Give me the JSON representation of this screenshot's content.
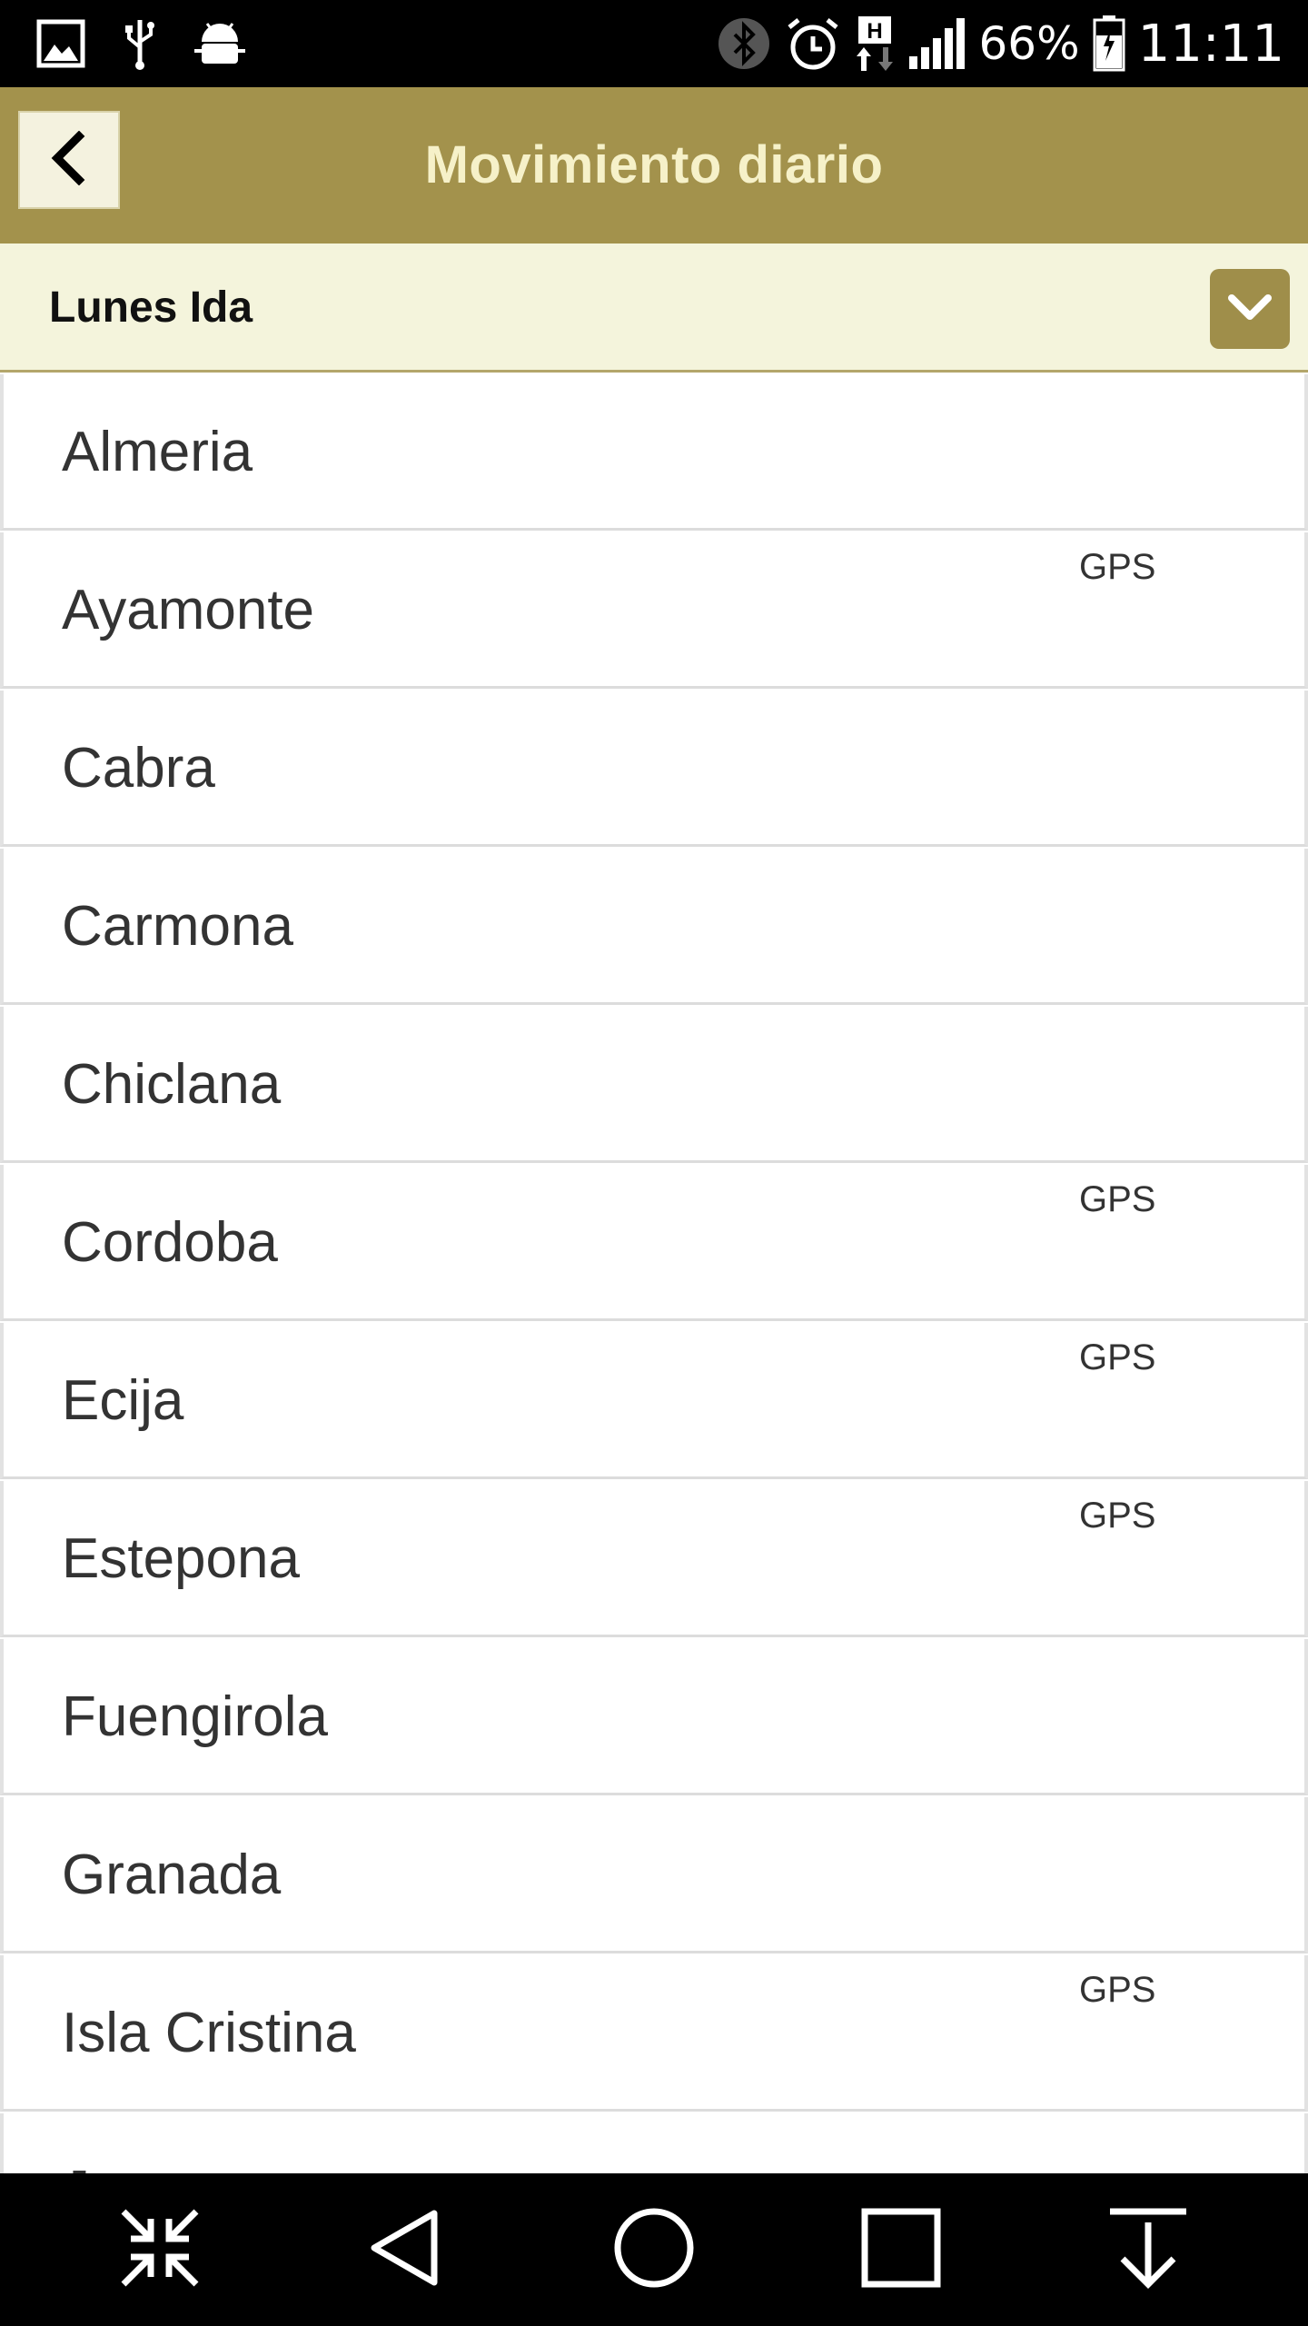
{
  "status_bar": {
    "battery": "66%",
    "time": "11:11",
    "icons": [
      "image-icon",
      "usb-icon",
      "android-debug-icon",
      "bluetooth-icon",
      "alarm-icon",
      "hplus-data-icon",
      "signal-icon",
      "battery-charging-icon"
    ]
  },
  "header": {
    "title": "Movimiento diario",
    "back_icon": "chevron-left-icon"
  },
  "selector": {
    "selected": "Lunes Ida",
    "toggle_icon": "chevron-down-icon"
  },
  "list": {
    "items": [
      {
        "name": "Almeria",
        "badge": ""
      },
      {
        "name": "Ayamonte",
        "badge": "GPS"
      },
      {
        "name": "Cabra",
        "badge": ""
      },
      {
        "name": "Carmona",
        "badge": ""
      },
      {
        "name": "Chiclana",
        "badge": ""
      },
      {
        "name": "Cordoba",
        "badge": "GPS"
      },
      {
        "name": "Ecija",
        "badge": "GPS"
      },
      {
        "name": "Estepona",
        "badge": "GPS"
      },
      {
        "name": "Fuengirola",
        "badge": ""
      },
      {
        "name": "Granada",
        "badge": ""
      },
      {
        "name": "Isla Cristina",
        "badge": "GPS"
      },
      {
        "name": "J",
        "badge": ""
      }
    ]
  },
  "nav_bar": {
    "buttons": [
      "shrink-icon",
      "back-triangle-icon",
      "home-circle-icon",
      "recents-square-icon",
      "notification-pull-down-icon"
    ]
  },
  "colors": {
    "header_bg": "#a3924c",
    "title_text": "#f6f1c9",
    "selector_bg": "#f4f4dc",
    "toggle_bg": "#9f8e4a"
  }
}
